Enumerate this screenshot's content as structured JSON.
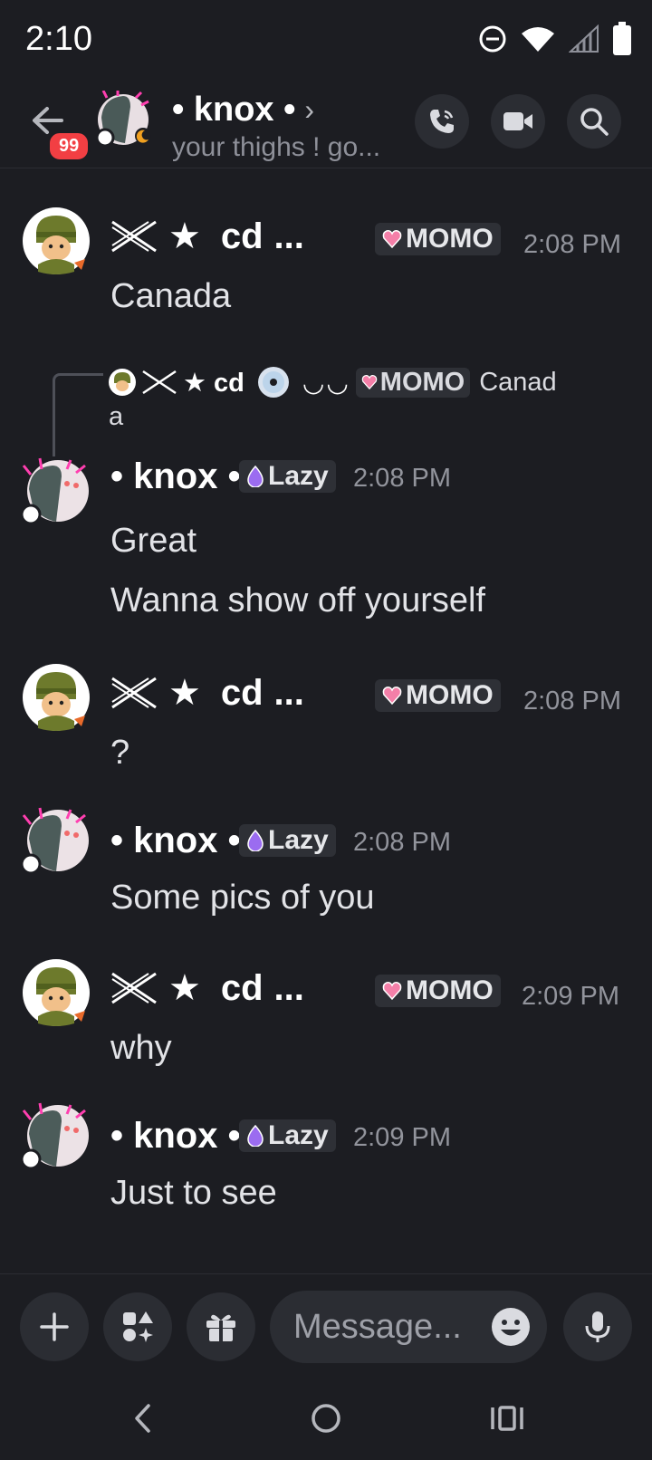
{
  "status_bar": {
    "time": "2:10"
  },
  "header": {
    "unread_badge": "99",
    "title": "• knox •",
    "subtitle": "your thighs ! go...",
    "chevron": "›",
    "actions": [
      "phone-call-icon",
      "video-icon",
      "search-icon"
    ]
  },
  "users": {
    "cd": {
      "name_prefix": "★",
      "name": "cd",
      "ellipsis": "...",
      "tag": "MOMO",
      "tag_icon": "heart-icon"
    },
    "knox": {
      "name": "• knox •",
      "tag": "Lazy",
      "tag_icon": "flame-icon"
    }
  },
  "reply": {
    "name": "★  cd",
    "decor": "◡◡",
    "tag": "MOMO",
    "text_line1": "Canad",
    "text_line2": "a"
  },
  "messages": [
    {
      "author": "cd",
      "time": "2:08 PM",
      "lines": [
        "Canada"
      ]
    },
    {
      "author": "knox",
      "time": "2:08 PM",
      "lines": [
        "Great",
        "Wanna show off yourself"
      ]
    },
    {
      "author": "cd",
      "time": "2:08 PM",
      "lines": [
        "?"
      ]
    },
    {
      "author": "knox",
      "time": "2:08 PM",
      "lines": [
        "Some pics of you"
      ]
    },
    {
      "author": "cd",
      "time": "2:09 PM",
      "lines": [
        "why"
      ]
    },
    {
      "author": "knox",
      "time": "2:09 PM",
      "lines": [
        "Just to see"
      ]
    }
  ],
  "composer": {
    "placeholder": "Message..."
  },
  "colors": {
    "background": "#1c1d22",
    "badge": "#f23f43",
    "lazy_icon": "#9b6cf0",
    "momo_icon": "#f47fa8"
  }
}
